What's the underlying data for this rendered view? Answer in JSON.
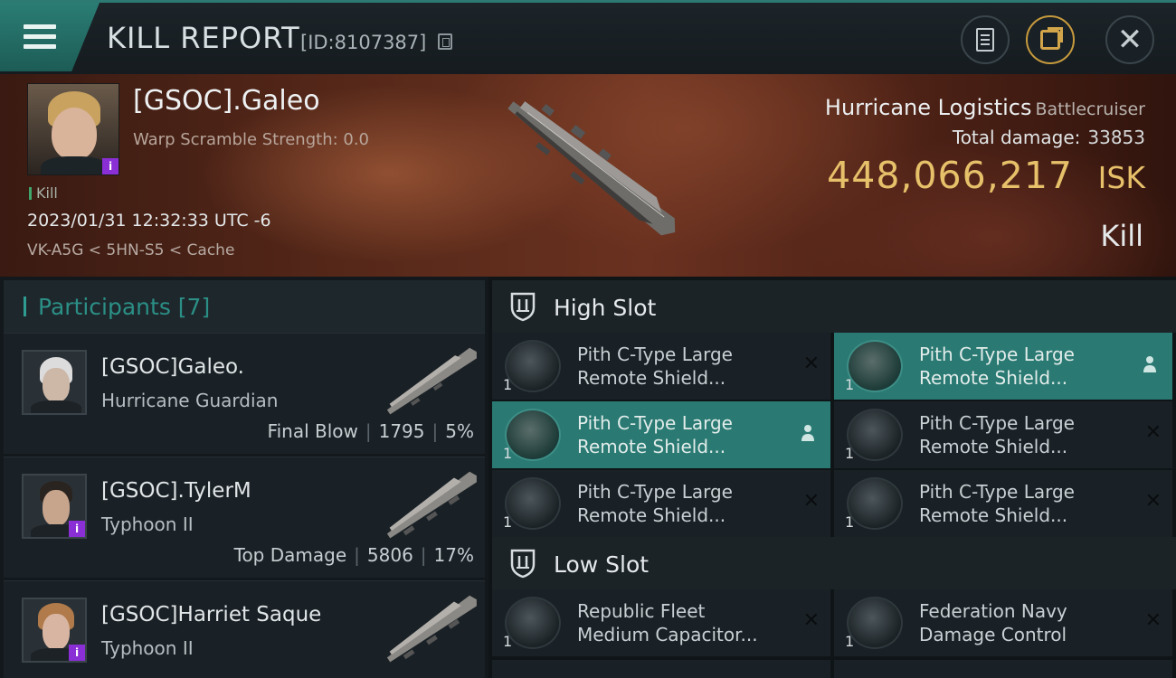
{
  "header": {
    "title": "KILL REPORT",
    "report_id": "[ID:8107387]",
    "colors": {
      "accent": "#2c7a72",
      "gold": "#d2a54b"
    },
    "icons": [
      "menu-icon",
      "copy-icon",
      "document-icon",
      "share-icon",
      "close-icon"
    ]
  },
  "victim": {
    "name": "[GSOC].Galeo",
    "warp_scramble": "Warp Scramble Strength: 0.0",
    "tag": "Kill",
    "datetime": "2023/01/31 12:32:33 UTC -6",
    "location": "VK-A5G < 5HN-S5 < Cache",
    "ship_name": "Hurricane Logistics",
    "ship_class": "Battlecruiser",
    "total_damage_label": "Total damage:",
    "total_damage": "33853",
    "isk_value": "448,066,217",
    "isk_unit": "ISK",
    "result": "Kill",
    "colors": {
      "isk": "#e7c06a"
    }
  },
  "participants": {
    "label": "Participants [7]",
    "rows": [
      {
        "name": "[GSOC]Galeo.",
        "ship": "Hurricane Guardian",
        "role": "Final Blow",
        "damage": "1795",
        "percent": "5%"
      },
      {
        "name": "[GSOC].TylerM",
        "ship": "Typhoon II",
        "role": "Top Damage",
        "damage": "5806",
        "percent": "17%"
      },
      {
        "name": "[GSOC]Harriet Saque",
        "ship": "Typhoon II",
        "role": "",
        "damage": "",
        "percent": ""
      }
    ]
  },
  "fittings": {
    "high_slot": {
      "label": "High Slot",
      "modules": [
        {
          "qty": "1",
          "line1": "Pith C-Type Large",
          "line2": "Remote Shield...",
          "selected": false
        },
        {
          "qty": "1",
          "line1": "Pith C-Type Large",
          "line2": "Remote Shield...",
          "selected": true
        },
        {
          "qty": "1",
          "line1": "Pith C-Type Large",
          "line2": "Remote Shield...",
          "selected": true
        },
        {
          "qty": "1",
          "line1": "Pith C-Type Large",
          "line2": "Remote Shield...",
          "selected": false
        },
        {
          "qty": "1",
          "line1": "Pith C-Type Large",
          "line2": "Remote Shield...",
          "selected": false
        },
        {
          "qty": "1",
          "line1": "Pith C-Type Large",
          "line2": "Remote Shield...",
          "selected": false
        }
      ]
    },
    "low_slot": {
      "label": "Low Slot",
      "modules": [
        {
          "qty": "1",
          "line1": "Republic Fleet",
          "line2": "Medium Capacitor...",
          "selected": false
        },
        {
          "qty": "1",
          "line1": "Federation Navy",
          "line2": "Damage Control",
          "selected": false
        }
      ]
    }
  }
}
